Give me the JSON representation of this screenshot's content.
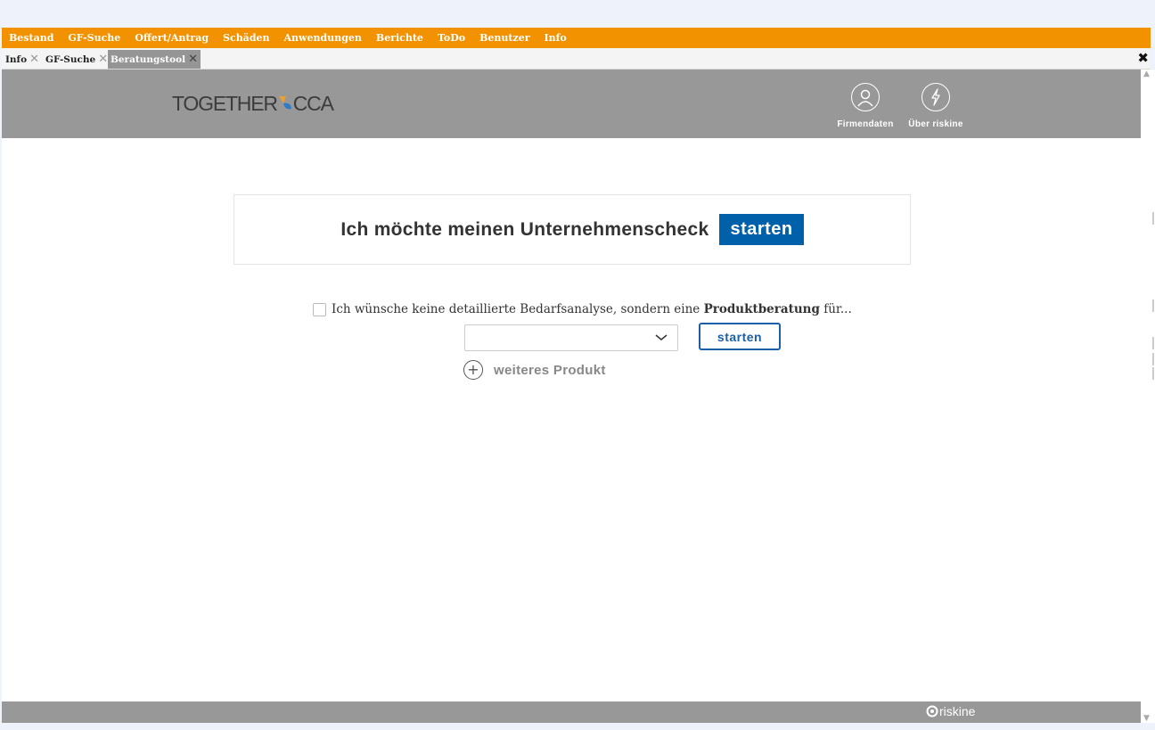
{
  "menu": {
    "items": [
      "Bestand",
      "GF-Suche",
      "Offert/Antrag",
      "Schäden",
      "Anwendungen",
      "Berichte",
      "ToDo",
      "Benutzer",
      "Info"
    ]
  },
  "tabs": [
    {
      "label": "Info",
      "active": false
    },
    {
      "label": "GF-Suche",
      "active": false
    },
    {
      "label": "Beratungstool",
      "active": true
    }
  ],
  "header": {
    "logo_left": "TOGETHER",
    "logo_right": "CCA",
    "company_label": "Firmendaten",
    "about_label": "Über riskine"
  },
  "main": {
    "check_text": "Ich möchte meinen Unternehmenscheck",
    "start_label": "starten",
    "product_checkbox_pre": "Ich wünsche keine detaillierte Bedarfsanalyse, sondern eine ",
    "product_checkbox_bold": "Produktberatung",
    "product_checkbox_post": " für...",
    "product_select_value": "",
    "product_start_label": "starten",
    "add_product_label": "weiteres Produkt"
  },
  "footer": {
    "brand": "riskine"
  },
  "colors": {
    "menubar": "#f39200",
    "header": "#989898",
    "primary": "#0060aa",
    "outline": "#1a5fa8",
    "logo_accent": "#2e7ac4",
    "logo_accent2": "#e8a030"
  }
}
